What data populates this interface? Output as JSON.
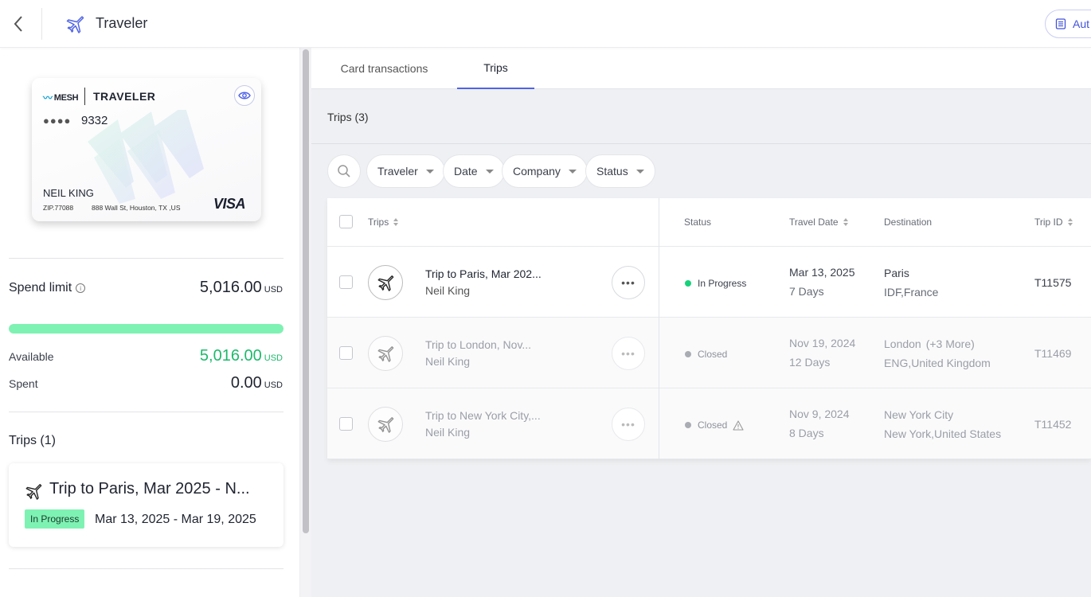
{
  "header": {
    "title": "Traveler",
    "auto_button_label": "Aut"
  },
  "card": {
    "brand_mark": "MESH",
    "product": "TRAVELER",
    "masked_dots": "●●●●",
    "last4": "9332",
    "holder": "NEIL KING",
    "zip": "ZIP.77088",
    "address": "888 Wall St, Houston, TX ,US",
    "network": "VISA"
  },
  "spend": {
    "label": "Spend limit",
    "limit_amount": "5,016.00",
    "currency": "USD",
    "progress_fraction": 1.0,
    "available_label": "Available",
    "available_amount": "5,016.00",
    "spent_label": "Spent",
    "spent_amount": "0.00"
  },
  "left_trips": {
    "title": "Trips (1)",
    "items": [
      {
        "title": "Trip to Paris, Mar 2025 - N...",
        "status": "In Progress",
        "dates": "Mar 13, 2025 - Mar 19, 2025"
      }
    ]
  },
  "tabs": [
    {
      "label": "Card transactions",
      "active": false
    },
    {
      "label": "Trips",
      "active": true
    }
  ],
  "trips_panel": {
    "count_label": "Trips (3)",
    "filters": [
      "Traveler",
      "Date",
      "Company",
      "Status"
    ],
    "columns": {
      "trips": "Trips",
      "status": "Status",
      "travel_date": "Travel Date",
      "destination": "Destination",
      "trip_id": "Trip ID"
    },
    "rows": [
      {
        "title": "Trip to Paris, Mar 202...",
        "traveler": "Neil King",
        "status": "In Progress",
        "date": "Mar 13, 2025",
        "duration": "7 Days",
        "city": "Paris",
        "more": "",
        "region": "IDF,France",
        "trip_id": "T11575"
      },
      {
        "title": "Trip to London, Nov...",
        "traveler": "Neil King",
        "status": "Closed",
        "date": "Nov 19, 2024",
        "duration": "12 Days",
        "city": "London",
        "more": "(+3 More)",
        "region": "ENG,United Kingdom",
        "trip_id": "T11469"
      },
      {
        "title": "Trip to New York City,...",
        "traveler": "Neil King",
        "status": "Closed",
        "date": "Nov 9, 2024",
        "duration": "8 Days",
        "city": "New York City",
        "more": "",
        "region": "New York,United States",
        "trip_id": "T11452"
      }
    ]
  },
  "colors": {
    "accent": "#4F63E6",
    "progress_green": "#7EF2B3",
    "available_green": "#1DB96B",
    "status_in_progress": "#16D27A",
    "status_closed": "#A9ACB2"
  },
  "icons": [
    "back-chevron-icon",
    "plane-icon",
    "eye-icon",
    "info-icon",
    "search-icon",
    "more-dots-icon",
    "warning-icon",
    "document-icon"
  ]
}
